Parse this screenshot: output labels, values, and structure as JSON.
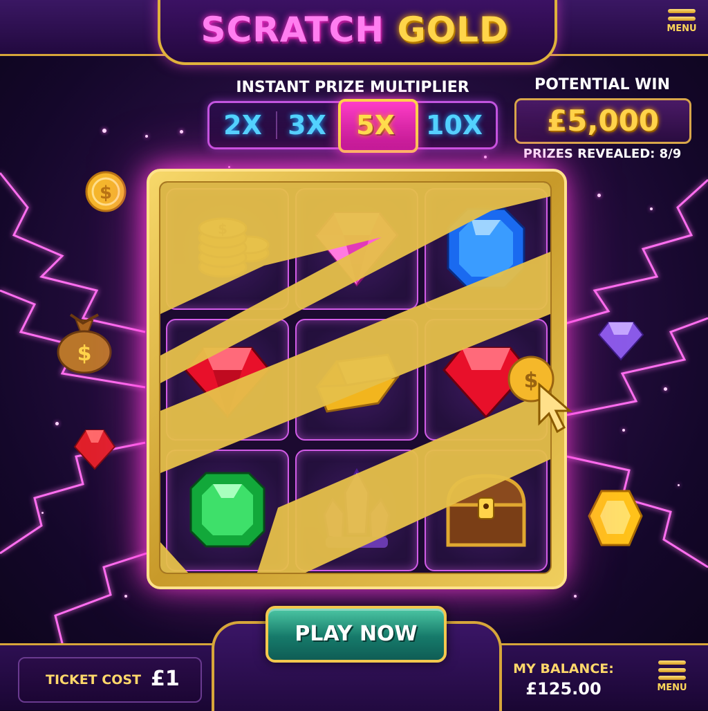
{
  "header": {
    "title_part1": "SCRATCH",
    "title_part2": "GOLD",
    "menu_label": "MENU"
  },
  "multiplier": {
    "label": "INSTANT PRIZE MULTIPLIER",
    "options": [
      "2X",
      "3X",
      "5X",
      "10X"
    ],
    "selected": "5X"
  },
  "potential_win": {
    "label": "POTENTIAL WIN",
    "value": "£5,000"
  },
  "prizes_revealed": "PRIZES REVEALED: 8/9",
  "card": {
    "cells": [
      {
        "symbol": "gold-coins-icon"
      },
      {
        "symbol": "pink-diamond-icon"
      },
      {
        "symbol": "blue-gem-icon"
      },
      {
        "symbol": "red-gem-icon"
      },
      {
        "symbol": "gold-bar-icon"
      },
      {
        "symbol": "red-gem-icon"
      },
      {
        "symbol": "green-emerald-icon"
      },
      {
        "symbol": "purple-crystal-icon"
      },
      {
        "symbol": "treasure-chest-icon"
      }
    ]
  },
  "play_button_label": "PLAY NOW",
  "ticket": {
    "label": "TICKET COST",
    "value": "£1"
  },
  "balance": {
    "label": "MY BALANCE:",
    "value": "£125.00"
  },
  "colors": {
    "gold": "#ffd34a",
    "magenta": "#ff3ec8",
    "cyan": "#4fd6ff",
    "play_green": "#167a6a"
  }
}
